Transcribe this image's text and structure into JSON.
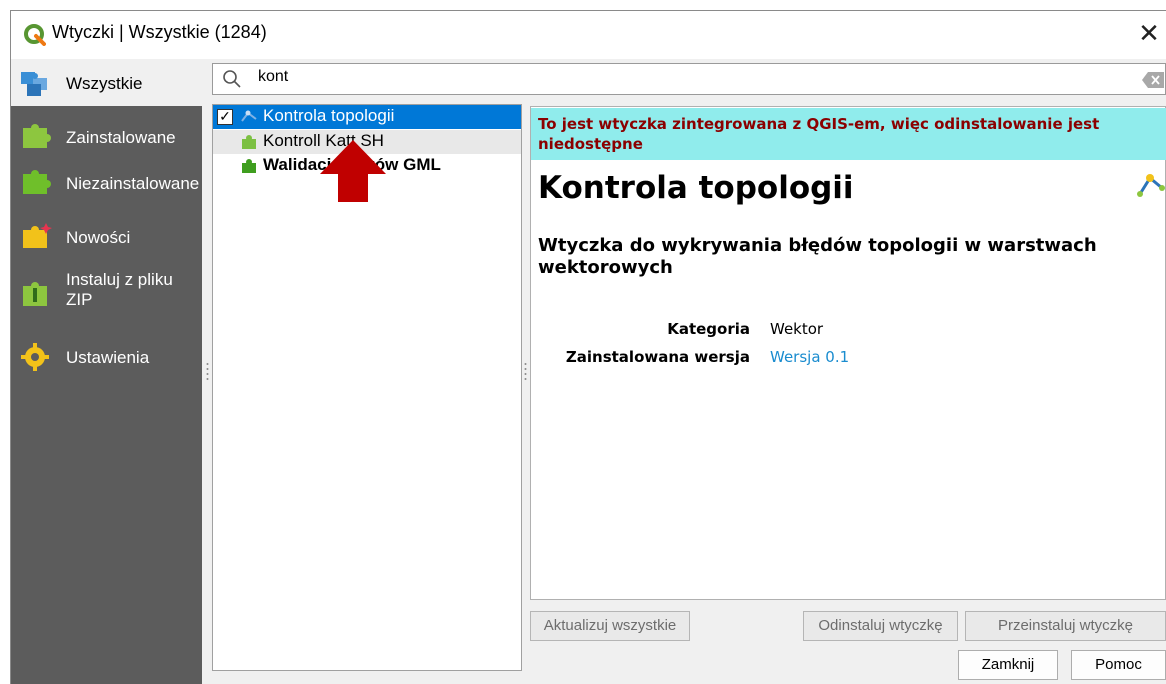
{
  "window": {
    "title": "Wtyczki | Wszystkie (1284)",
    "close_glyph": "✕"
  },
  "sidebar": {
    "items": [
      {
        "label": "Wszystkie",
        "icon": "puzzle-multi-icon"
      },
      {
        "label": "Zainstalowane",
        "icon": "puzzle-green-icon"
      },
      {
        "label": "Niezainstalowane",
        "icon": "puzzle-green-icon"
      },
      {
        "label": "Nowości",
        "icon": "puzzle-new-icon"
      },
      {
        "label": "Instaluj z pliku ZIP",
        "icon": "puzzle-zip-icon"
      },
      {
        "label": "Ustawienia",
        "icon": "gear-icon"
      }
    ]
  },
  "search": {
    "value": "kont"
  },
  "plugin_list": {
    "items": [
      {
        "label": "Kontrola topologii",
        "checked": true,
        "selected": true
      },
      {
        "label": "Kontroll Katt SH",
        "checked": false,
        "selected": false
      },
      {
        "label": "Walidacja plików GML",
        "checked": false,
        "selected": false
      }
    ]
  },
  "details": {
    "banner": "To jest wtyczka zintegrowana z QGIS-em, więc odinstalowanie jest niedostępne",
    "title": "Kontrola topologii",
    "description": "Wtyczka do wykrywania błędów topologii w warstwach wektorowych",
    "category_label": "Kategoria",
    "category_value": "Wektor",
    "version_label": "Zainstalowana wersja",
    "version_value": "Wersja 0.1"
  },
  "buttons": {
    "upgrade_all": "Aktualizuj wszystkie",
    "uninstall": "Odinstaluj wtyczkę",
    "reinstall": "Przeinstaluj wtyczkę",
    "close": "Zamknij",
    "help": "Pomoc"
  },
  "colors": {
    "selection": "#0078d7",
    "banner_bg": "#90ecec",
    "banner_text": "#8b0000",
    "sidebar_bg": "#5c5c5c",
    "link": "#1a8ccf",
    "annotation_arrow": "#c00000"
  }
}
